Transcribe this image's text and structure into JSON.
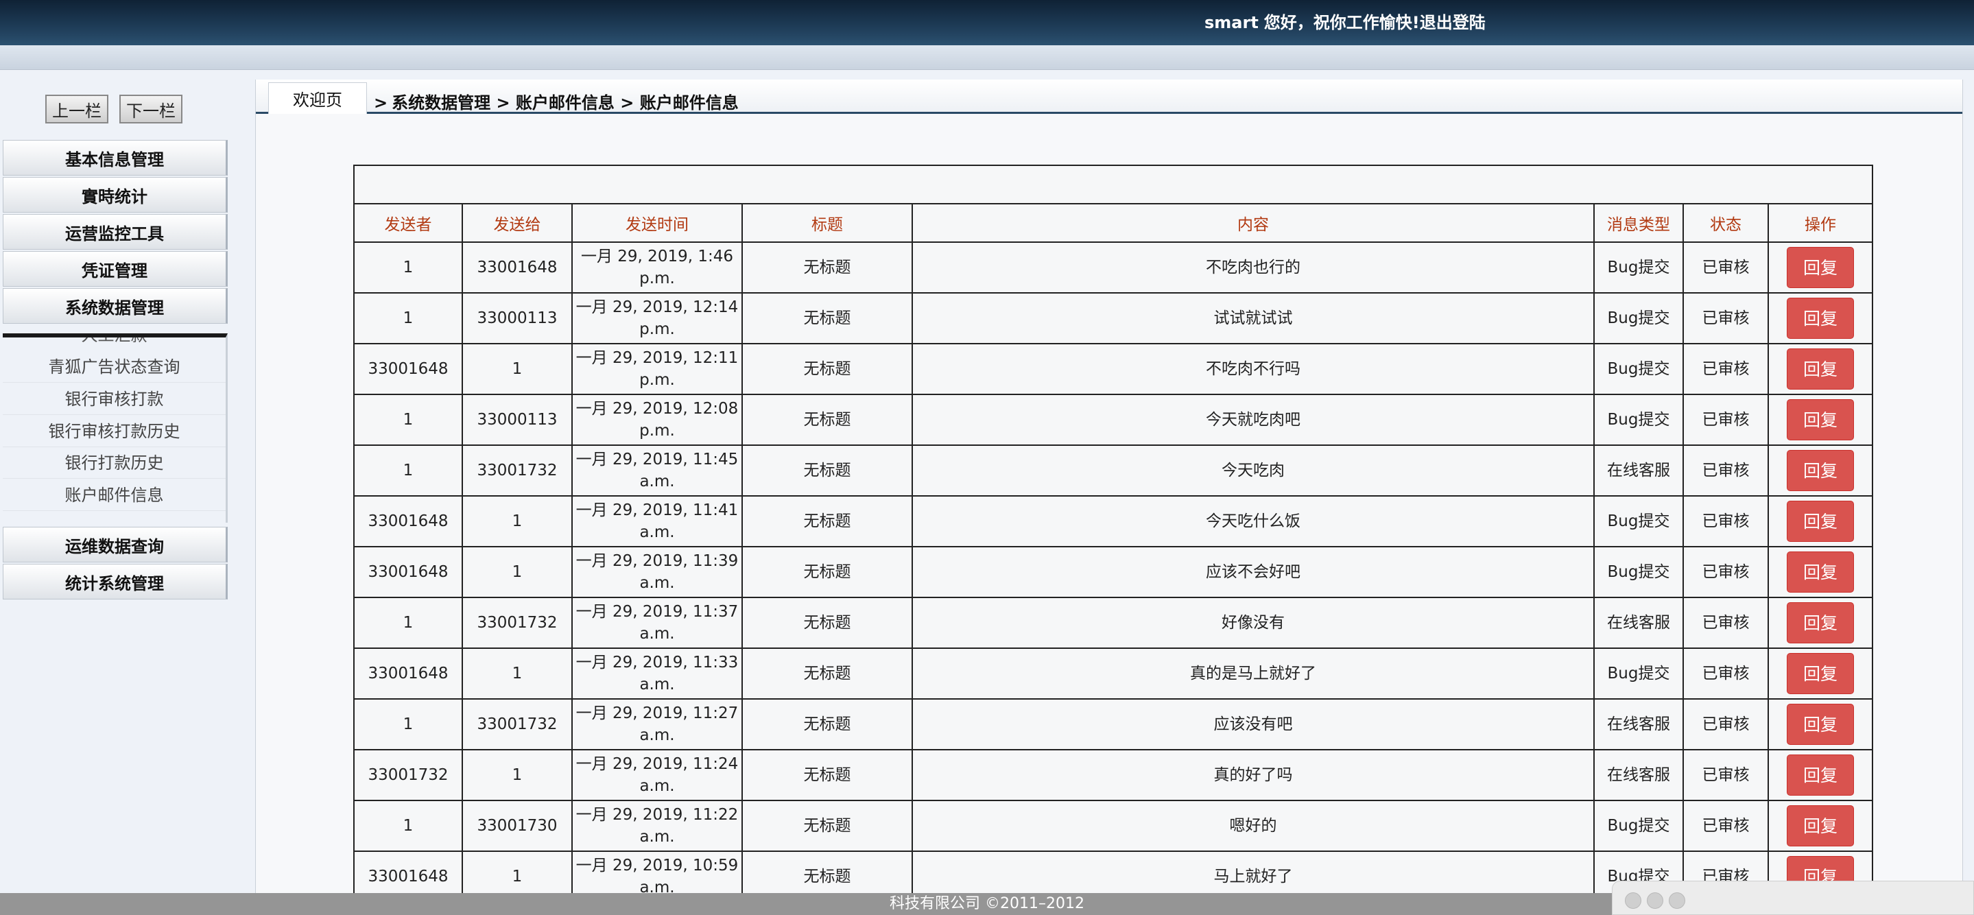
{
  "header": {
    "username": "smart",
    "greeting": "您好，祝你工作愉快!",
    "logout": "退出登陆"
  },
  "sidebar": {
    "prev_label": "上一栏",
    "next_label": "下一栏",
    "menus_top": [
      {
        "label": "基本信息管理"
      },
      {
        "label": "實時统计"
      },
      {
        "label": "运营监控工具"
      },
      {
        "label": "凭证管理"
      },
      {
        "label": "系统数据管理"
      }
    ],
    "submenu": {
      "partial_item": "人工汇款",
      "items": [
        {
          "label": "青狐广告状态查询"
        },
        {
          "label": "银行审核打款"
        },
        {
          "label": "银行审核打款历史"
        },
        {
          "label": "银行打款历史"
        },
        {
          "label": "账户邮件信息"
        }
      ]
    },
    "menus_bottom": [
      {
        "label": "运维数据查询"
      },
      {
        "label": "统计系统管理"
      }
    ]
  },
  "breadcrumb": {
    "home_tab": "欢迎页",
    "separator": ">",
    "path": "系统数据管理 > 账户邮件信息 > 账户邮件信息"
  },
  "table": {
    "headers": [
      "发送者",
      "发送给",
      "发送时间",
      "标题",
      "内容",
      "消息类型",
      "状态",
      "操作"
    ],
    "reply_label": "回复",
    "rows": [
      {
        "from": "1",
        "to": "33001648",
        "time": "一月 29, 2019, 1:46 p.m.",
        "title": "无标题",
        "content": "不吃肉也行的",
        "type": "Bug提交",
        "status": "已审核"
      },
      {
        "from": "1",
        "to": "33000113",
        "time": "一月 29, 2019, 12:14 p.m.",
        "title": "无标题",
        "content": "试试就试试",
        "type": "Bug提交",
        "status": "已审核"
      },
      {
        "from": "33001648",
        "to": "1",
        "time": "一月 29, 2019, 12:11 p.m.",
        "title": "无标题",
        "content": "不吃肉不行吗",
        "type": "Bug提交",
        "status": "已审核"
      },
      {
        "from": "1",
        "to": "33000113",
        "time": "一月 29, 2019, 12:08 p.m.",
        "title": "无标题",
        "content": "今天就吃肉吧",
        "type": "Bug提交",
        "status": "已审核"
      },
      {
        "from": "1",
        "to": "33001732",
        "time": "一月 29, 2019, 11:45 a.m.",
        "title": "无标题",
        "content": "今天吃肉",
        "type": "在线客服",
        "status": "已审核"
      },
      {
        "from": "33001648",
        "to": "1",
        "time": "一月 29, 2019, 11:41 a.m.",
        "title": "无标题",
        "content": "今天吃什么饭",
        "type": "Bug提交",
        "status": "已审核"
      },
      {
        "from": "33001648",
        "to": "1",
        "time": "一月 29, 2019, 11:39 a.m.",
        "title": "无标题",
        "content": "应该不会好吧",
        "type": "Bug提交",
        "status": "已审核"
      },
      {
        "from": "1",
        "to": "33001732",
        "time": "一月 29, 2019, 11:37 a.m.",
        "title": "无标题",
        "content": "好像没有",
        "type": "在线客服",
        "status": "已审核"
      },
      {
        "from": "33001648",
        "to": "1",
        "time": "一月 29, 2019, 11:33 a.m.",
        "title": "无标题",
        "content": "真的是马上就好了",
        "type": "Bug提交",
        "status": "已审核"
      },
      {
        "from": "1",
        "to": "33001732",
        "time": "一月 29, 2019, 11:27 a.m.",
        "title": "无标题",
        "content": "应该没有吧",
        "type": "在线客服",
        "status": "已审核"
      },
      {
        "from": "33001732",
        "to": "1",
        "time": "一月 29, 2019, 11:24 a.m.",
        "title": "无标题",
        "content": "真的好了吗",
        "type": "在线客服",
        "status": "已审核"
      },
      {
        "from": "1",
        "to": "33001730",
        "time": "一月 29, 2019, 11:22 a.m.",
        "title": "无标题",
        "content": "嗯好的",
        "type": "Bug提交",
        "status": "已审核"
      },
      {
        "from": "33001648",
        "to": "1",
        "time": "一月 29, 2019, 10:59 a.m.",
        "title": "无标题",
        "content": "马上就好了",
        "type": "Bug提交",
        "status": "已审核"
      }
    ]
  },
  "footer": {
    "copyright": "科技有限公司 ©2011–2012"
  },
  "colors": {
    "header_bg": "#1d3a55",
    "header_text": "#b23a12",
    "reply_button": "#d9534f"
  }
}
